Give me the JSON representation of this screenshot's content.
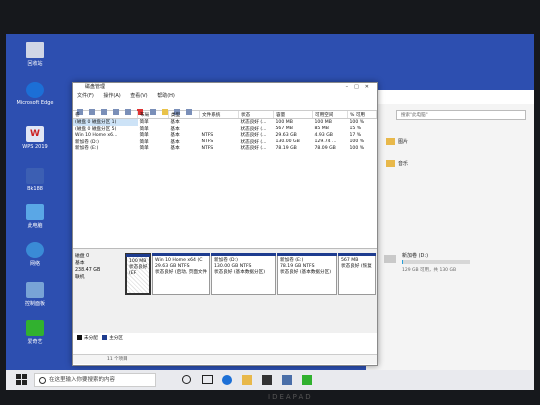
{
  "desktop": {
    "icons": [
      {
        "label": "回收站",
        "glyph": "recycle-bin-icon"
      },
      {
        "label": "Microsoft Edge",
        "glyph": "edge-icon"
      },
      {
        "label": "WPS 2019",
        "glyph": "wps-icon"
      },
      {
        "label": "Bk188",
        "glyph": "app-icon"
      },
      {
        "label": "此电脑",
        "glyph": "this-pc-icon"
      },
      {
        "label": "网络",
        "glyph": "network-icon"
      },
      {
        "label": "控制面板",
        "glyph": "control-panel-icon"
      },
      {
        "label": "爱奇艺",
        "glyph": "iqiyi-icon"
      }
    ]
  },
  "explorer": {
    "search_placeholder": "搜索\"此电脑\"",
    "folders": [
      "图片",
      "音乐"
    ],
    "drive": {
      "label": "新加卷 (D:)",
      "free_text": "129 GB 可用，共 130 GB",
      "used_fraction": 0.01
    }
  },
  "disk_management": {
    "title": "磁盘管理",
    "menu": [
      "文件(F)",
      "操作(A)",
      "查看(V)",
      "帮助(H)"
    ],
    "columns": [
      "卷",
      "布局",
      "类型",
      "文件系统",
      "状态",
      "容量",
      "可用空间",
      "% 可用"
    ],
    "volumes": [
      [
        "(磁盘 0 磁盘分区 1)",
        "简单",
        "基本",
        "",
        "状态良好 (...",
        "100 MB",
        "100 MB",
        "100 %"
      ],
      [
        "(磁盘 0 磁盘分区 5)",
        "简单",
        "基本",
        "",
        "状态良好 (...",
        "567 MB",
        "85 MB",
        "15 %"
      ],
      [
        "Win 10 Home x6...",
        "简单",
        "基本",
        "NTFS",
        "状态良好 (...",
        "29.63 GB",
        "4.93 GB",
        "17 %"
      ],
      [
        "新加卷 (D:)",
        "简单",
        "基本",
        "NTFS",
        "状态良好 (...",
        "130.00 GB",
        "129.74 ...",
        "100 %"
      ],
      [
        "新加卷 (E:)",
        "简单",
        "基本",
        "NTFS",
        "状态良好 (...",
        "78.19 GB",
        "78.09 GB",
        "100 %"
      ]
    ],
    "disk": {
      "name": "磁盘 0",
      "type": "基本",
      "size": "238.47 GB",
      "status": "联机"
    },
    "partitions": [
      {
        "title": "",
        "line1": "100 MB",
        "line2": "状态良好 (EF"
      },
      {
        "title": "Win 10 Home x64 (C",
        "line1": "29.63 GB NTFS",
        "line2": "状态良好 (启动, 页面文件"
      },
      {
        "title": "新加卷 (D:)",
        "line1": "130.00 GB NTFS",
        "line2": "状态良好 (基本数据分区)"
      },
      {
        "title": "新加卷 (E:)",
        "line1": "78.19 GB NTFS",
        "line2": "状态良好 (基本数据分区)"
      },
      {
        "title": "",
        "line1": "567 MB",
        "line2": "状态良好 (恢复"
      }
    ],
    "legend": [
      "未分配",
      "主分区"
    ],
    "status_text": "11 个项目",
    "colors": {
      "primary_partition": "#1e3c8f",
      "unallocated": "#111111"
    }
  },
  "taskbar": {
    "search_placeholder": "在这里输入你要搜索的内容"
  },
  "laptop_logo": "IDEAPAD"
}
